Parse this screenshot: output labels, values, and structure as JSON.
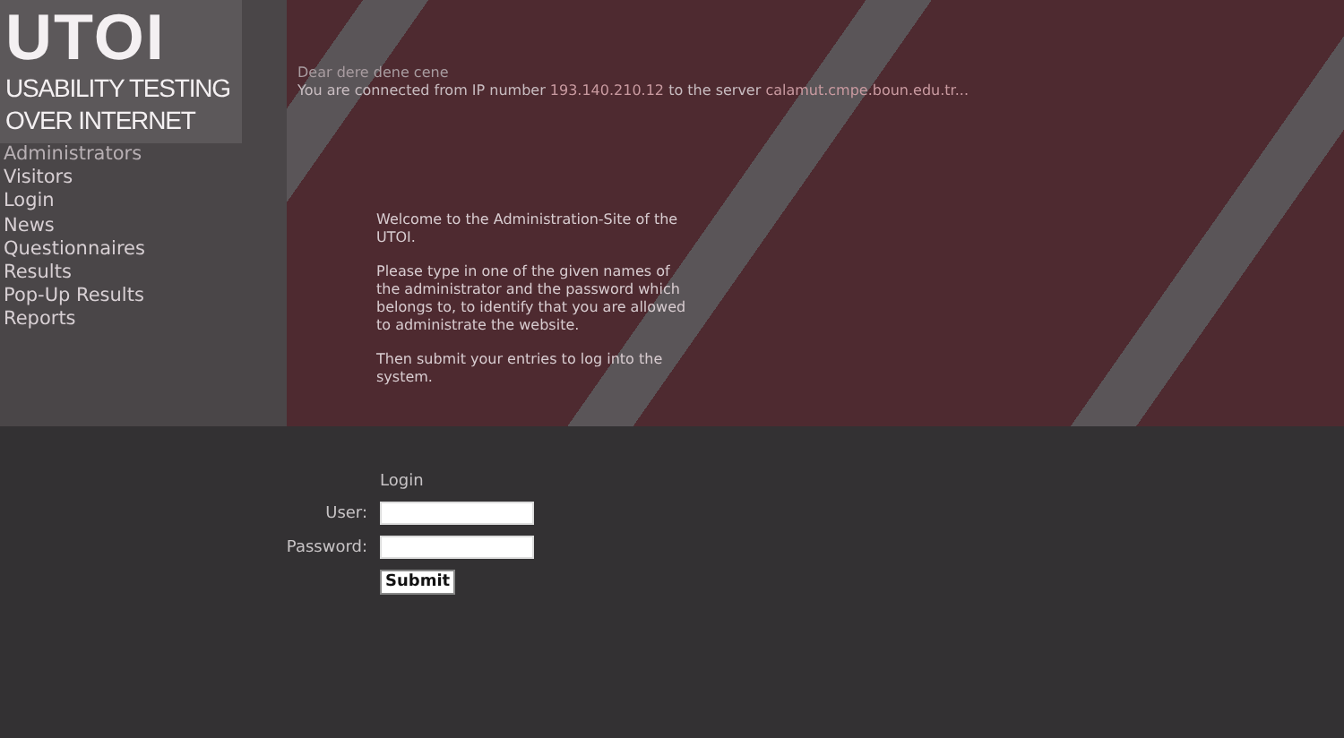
{
  "logo": {
    "title": "UTOI",
    "subtitle_lines": [
      "USABILITY TESTING",
      "OVER INTERNET"
    ]
  },
  "sidebar": {
    "items": [
      {
        "label": "Administrators",
        "selected": true
      },
      {
        "label": "Visitors",
        "selected": false
      },
      {
        "label": "Login",
        "selected": false
      },
      {
        "label": "News",
        "selected": false
      },
      {
        "label": "Questionnaires",
        "selected": false
      },
      {
        "label": "Results",
        "selected": false
      },
      {
        "label": "Pop-Up Results",
        "selected": false
      },
      {
        "label": "Reports",
        "selected": false
      }
    ]
  },
  "header": {
    "greeting": "Dear dere  dene  cene",
    "connection": {
      "before": "You are connected from IP number ",
      "ip": "193.140.210.12",
      "middle": " to the server ",
      "server": "calamut.cmpe.boun.edu.tr..."
    }
  },
  "intro": [
    "Welcome to the Administration-Site of the UTOI.",
    "Please type in one of the given names of the administrator and the password which belongs to, to identify that you are allowed to administrate the website.",
    "Then submit your entries to log into the system."
  ],
  "login": {
    "heading": "Login",
    "fields": [
      {
        "label": "User:"
      },
      {
        "label": "Password:"
      }
    ],
    "submit": "Submit"
  }
}
